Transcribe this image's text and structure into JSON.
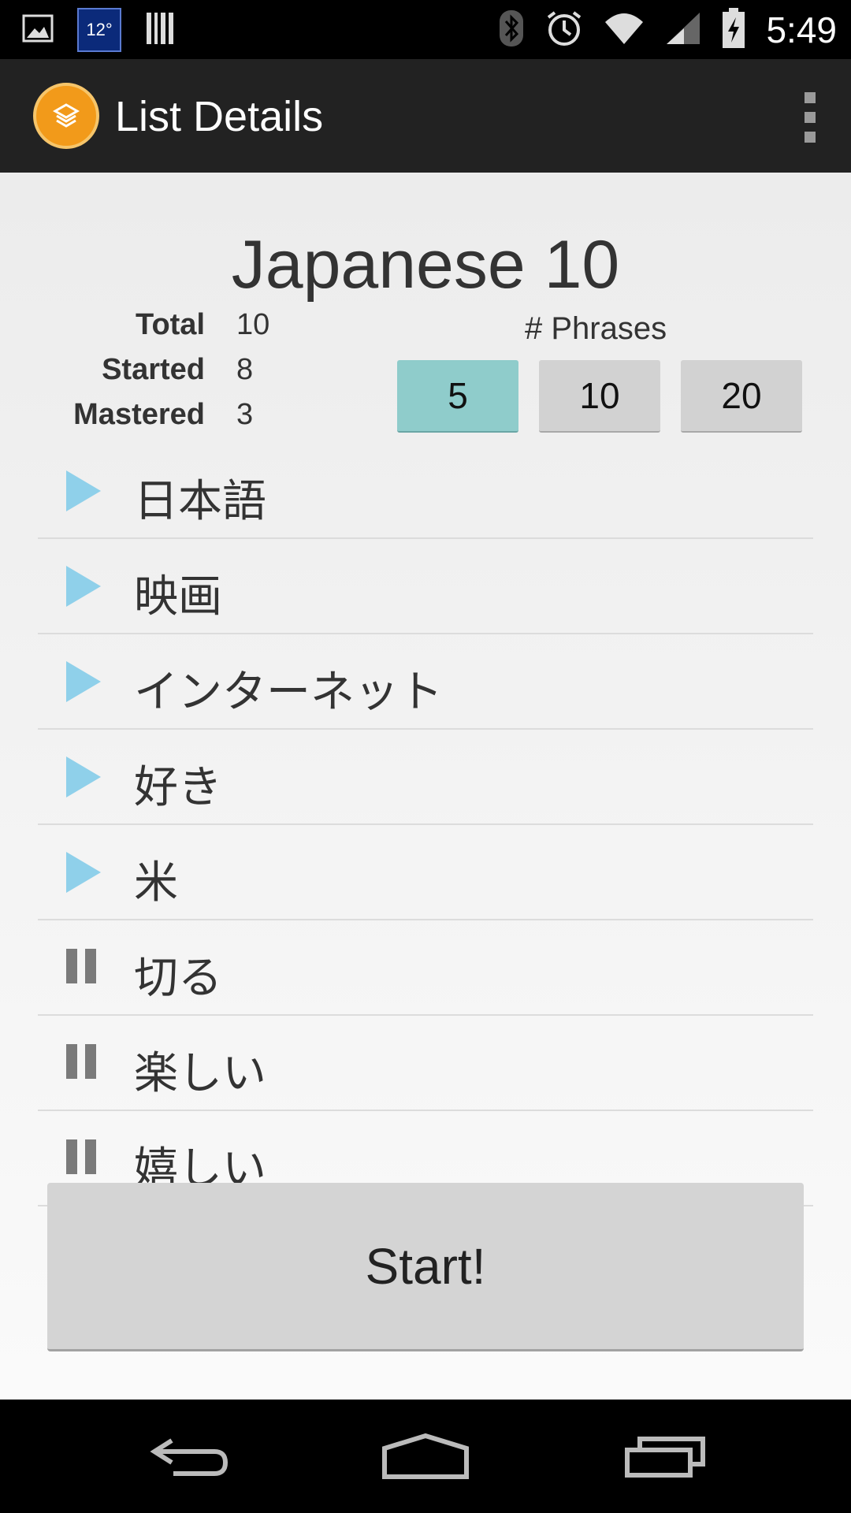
{
  "status_bar": {
    "weather_temp": "12°",
    "time": "5:49",
    "icons": [
      "image-icon",
      "weather-icon",
      "barcode-icon",
      "bluetooth-icon",
      "alarm-icon",
      "wifi-icon",
      "signal-icon",
      "battery-charging-icon"
    ]
  },
  "action_bar": {
    "title": "List Details",
    "app_icon": "layers-icon",
    "overflow_icon": "overflow-menu-icon"
  },
  "list": {
    "title": "Japanese 10",
    "stats": [
      {
        "label": "Total",
        "value": "10"
      },
      {
        "label": "Started",
        "value": "8"
      },
      {
        "label": "Mastered",
        "value": "3"
      }
    ],
    "phrases_label": "# Phrases",
    "phrase_counts": [
      "5",
      "10",
      "20"
    ],
    "selected_phrase_count": "5",
    "items": [
      {
        "text": "日本語",
        "status": "play"
      },
      {
        "text": "映画",
        "status": "play"
      },
      {
        "text": "インターネット",
        "status": "play"
      },
      {
        "text": "好き",
        "status": "play"
      },
      {
        "text": "米",
        "status": "play"
      },
      {
        "text": "切る",
        "status": "pause"
      },
      {
        "text": "楽しい",
        "status": "pause"
      },
      {
        "text": "嬉しい",
        "status": "pause"
      }
    ]
  },
  "start_button": "Start!",
  "colors": {
    "selected_button": "#8fcccb",
    "play_icon": "#8fd0ea",
    "app_icon": "#f29a1a",
    "action_bar": "#222222"
  },
  "nav_bar": {
    "buttons": [
      "back-icon",
      "home-icon",
      "recent-apps-icon"
    ]
  }
}
